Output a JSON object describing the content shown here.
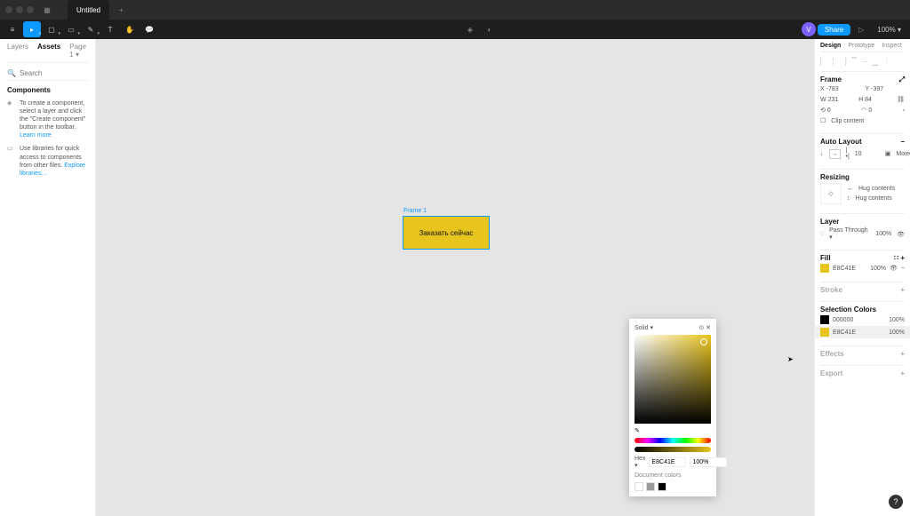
{
  "title_bar": {
    "tab_name": "Untitled"
  },
  "tool_bar": {
    "avatar_initial": "V",
    "share_label": "Share",
    "zoom": "100%"
  },
  "left_panel": {
    "tabs": {
      "layers": "Layers",
      "assets": "Assets",
      "page": "Page 1"
    },
    "search_placeholder": "Search",
    "components_heading": "Components",
    "tip1_text": "To create a component, select a layer and click the \"Create component\" button in the toolbar.",
    "tip1_link": "Learn more",
    "tip2_text": "Use libraries for quick access to components from other files.",
    "tip2_link": "Explore libraries..."
  },
  "canvas": {
    "frame_label": "Frame 1",
    "frame_text": "Заказать сейчас"
  },
  "right_panel": {
    "tabs": {
      "design": "Design",
      "prototype": "Prototype",
      "inspect": "Inspect"
    },
    "frame_section": {
      "title": "Frame",
      "x": "-783",
      "y": "-397",
      "w": "231",
      "h": "84",
      "rotation": "0",
      "radius": "0",
      "clip_label": "Clip content"
    },
    "autolayout": {
      "title": "Auto Layout",
      "gap": "10",
      "padding": "Mixed"
    },
    "resizing": {
      "title": "Resizing",
      "h_mode": "Hug contents",
      "v_mode": "Hug contents"
    },
    "layer": {
      "title": "Layer",
      "blend": "Pass Through",
      "pct": "100%"
    },
    "fill": {
      "title": "Fill",
      "hex": "E8C41E",
      "pct": "100%"
    },
    "stroke": {
      "title": "Stroke"
    },
    "selection_colors": {
      "title": "Selection Colors",
      "items": [
        {
          "hex": "000000",
          "pct": "100%"
        },
        {
          "hex": "E8C41E",
          "pct": "100%"
        }
      ]
    },
    "effects": {
      "title": "Effects"
    },
    "export_section": {
      "title": "Export"
    }
  },
  "color_picker": {
    "mode": "Solid",
    "hex_label": "Hex",
    "hex_value": "E8C41E",
    "pct": "100%",
    "doc_colors_label": "Document colors",
    "doc_swatches": [
      "#ffffff",
      "#999999",
      "#000000"
    ]
  },
  "colors": {
    "accent": "#0d99ff",
    "frame_fill": "#e8c41e"
  }
}
